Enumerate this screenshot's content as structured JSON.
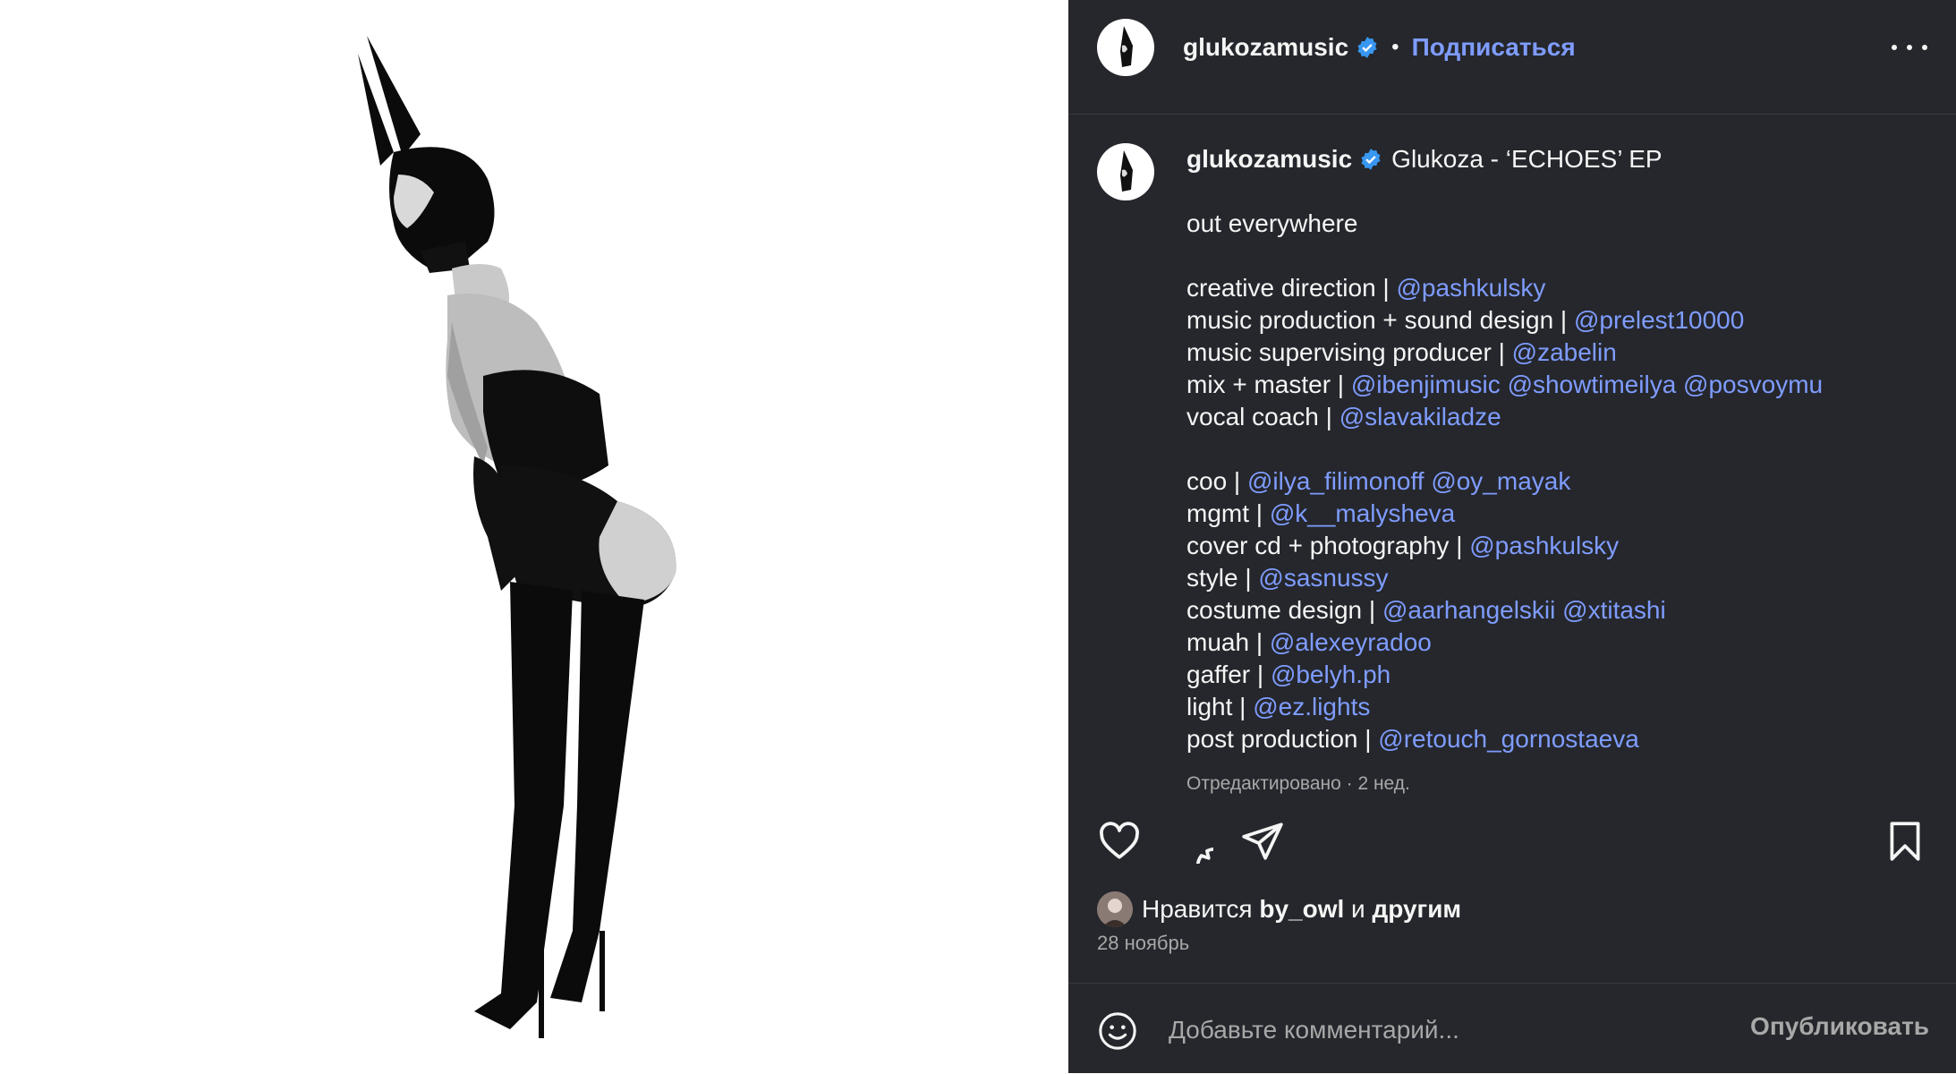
{
  "colors": {
    "panel_bg": "#25272c",
    "text": "#f5f5f5",
    "muted": "#a8a8a8",
    "link": "#7f9cff",
    "verified": "#3897f0"
  },
  "post": {
    "image_alt": "photo"
  },
  "header": {
    "username": "glukozamusic",
    "separator": "•",
    "follow_label": "Подписаться",
    "more_icon": "more-horizontal-icon"
  },
  "caption": {
    "username": "glukozamusic",
    "title": "Glukoza - ‘ECHOES’ EP",
    "lines": [
      {
        "text": "out everywhere",
        "mentions": []
      },
      {
        "text": "",
        "mentions": []
      },
      {
        "text": "creative direction | ",
        "mentions": [
          "@pashkulsky"
        ]
      },
      {
        "text": "music production + sound design | ",
        "mentions": [
          "@prelest10000"
        ]
      },
      {
        "text": "music supervising producer | ",
        "mentions": [
          "@zabelin"
        ]
      },
      {
        "text": "mix + master | ",
        "mentions": [
          "@ibenjimusic",
          "@showtimeilya",
          "@posvoymu"
        ]
      },
      {
        "text": "vocal coach | ",
        "mentions": [
          "@slavakiladze"
        ]
      },
      {
        "text": "",
        "mentions": []
      },
      {
        "text": "coo | ",
        "mentions": [
          "@ilya_filimonoff",
          "@oy_mayak"
        ]
      },
      {
        "text": "mgmt | ",
        "mentions": [
          "@k__malysheva"
        ]
      },
      {
        "text": "cover cd + photography | ",
        "mentions": [
          "@pashkulsky"
        ]
      },
      {
        "text": "style | ",
        "mentions": [
          "@sasnussy"
        ]
      },
      {
        "text": "costume design | ",
        "mentions": [
          "@aarhangelskii",
          "@xtitashi"
        ]
      },
      {
        "text": "muah | ",
        "mentions": [
          "@alexeyradoo"
        ]
      },
      {
        "text": "gaffer | ",
        "mentions": [
          "@belyh.ph"
        ]
      },
      {
        "text": "light | ",
        "mentions": [
          "@ez.lights"
        ]
      },
      {
        "text": "post production | ",
        "mentions": [
          "@retouch_gornostaeva"
        ]
      }
    ],
    "edited": "Отредактировано · 2 нед."
  },
  "actions": {
    "like_icon": "heart-icon",
    "comment_icon": "comment-icon",
    "share_icon": "send-icon",
    "save_icon": "bookmark-icon"
  },
  "likes": {
    "prefix": "Нравится",
    "user": "by_owl",
    "conj": "и",
    "others": "другим"
  },
  "date": "28 ноябрь",
  "comment": {
    "placeholder": "Добавьте комментарий...",
    "publish_label": "Опубликовать",
    "emoji_icon": "emoji-icon"
  }
}
